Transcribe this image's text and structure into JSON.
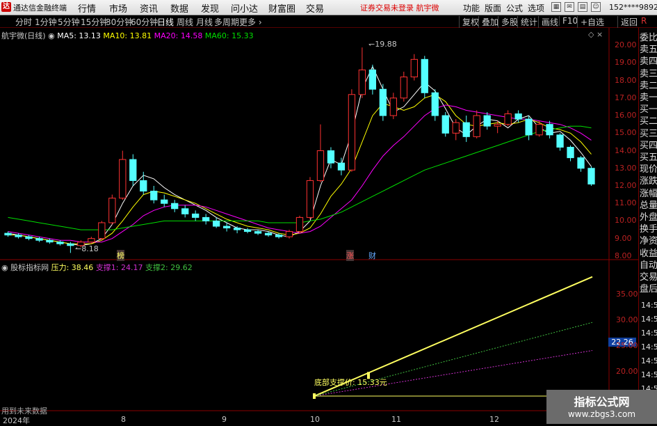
{
  "app": {
    "title": "通达信金融终端",
    "logo_glyph": "达"
  },
  "menu": {
    "items": [
      "行情",
      "市场",
      "资讯",
      "数据",
      "发现",
      "问小达",
      "财富圈",
      "交易"
    ],
    "warning": "证券交易未登录",
    "stock_name": "航宇微",
    "right_items": [
      "功能",
      "版面",
      "公式",
      "选项"
    ],
    "account": "152****9892"
  },
  "period_bar": {
    "periods": [
      "分时",
      "1分钟",
      "5分钟",
      "15分钟",
      "30分钟",
      "60分钟",
      "日线",
      "周线",
      "月线",
      "多周期",
      "更多"
    ],
    "active": "日线",
    "tools": [
      "复权",
      "叠加",
      "多股",
      "统计",
      "画线",
      "F10",
      "+自选",
      "返回"
    ],
    "r_icon": "R"
  },
  "main_legend": {
    "title": "航宇微(日线)",
    "ma5": "MA5: 13.13",
    "ma10": "MA10: 13.81",
    "ma20": "MA20: 14.58",
    "ma60": "MA60: 15.33"
  },
  "indicator_legend": {
    "name": "股标指标网",
    "pressure": "压力: 38.46",
    "support1": "支撑1: 24.17",
    "support2": "支撑2: 29.62"
  },
  "annotations": {
    "high": "19.88",
    "low": "8.18",
    "marker_bang": "榜",
    "marker_zhang": "涨",
    "marker_cai": "财",
    "bottom_support": "底部支撑价: 15.33元",
    "current_value": "22.26",
    "left_note": "用到未来数据"
  },
  "x_axis": {
    "labels": [
      "2024年",
      "8",
      "9",
      "10",
      "11",
      "12"
    ]
  },
  "colors": {
    "up": "#ff3232",
    "down": "#54ffff",
    "ma5": "#ffffff",
    "ma10": "#ffff00",
    "ma20": "#ff00ff",
    "ma60": "#00e000",
    "pressure": "#ffff60",
    "support1": "#d030d0",
    "support2": "#40c040"
  },
  "side_panel": {
    "items": [
      "委比",
      "卖五",
      "卖四",
      "卖三",
      "卖二",
      "卖一",
      "买一",
      "买二",
      "买三",
      "买四",
      "买五",
      "现价",
      "涨跌",
      "涨幅",
      "总量",
      "外盘",
      "换手",
      "净资",
      "收益",
      "自动",
      "交易",
      "盘后"
    ],
    "times": [
      "14:56",
      "14:56",
      "14:56",
      "14:56",
      "14:56",
      "14:56",
      "14:56",
      "14:56"
    ]
  },
  "watermark": {
    "line1": "指标公式网",
    "line2": "www.zbgs3.com"
  },
  "chart_data": [
    {
      "type": "candlestick",
      "title": "航宇微(日线)",
      "y_ticks": [
        20.0,
        19.0,
        18.0,
        17.0,
        16.0,
        15.0,
        14.0,
        13.0,
        12.0,
        11.0,
        10.0,
        9.0,
        8.0
      ],
      "ylim": [
        7.6,
        20.6
      ],
      "x_range": "2024-07 to 2024-12",
      "series": [
        {
          "name": "MA5",
          "values": [
            9.3,
            9.2,
            9.1,
            9.0,
            8.9,
            8.8,
            8.7,
            8.6,
            8.7,
            9.0,
            9.8,
            11.0,
            12.0,
            12.6,
            12.4,
            11.9,
            11.5,
            11.2,
            10.9,
            10.6,
            10.2,
            9.9,
            9.6,
            9.5,
            9.5,
            9.4,
            9.2,
            9.1,
            9.4,
            10.0,
            12.0,
            13.5,
            13.2,
            15.0,
            17.5,
            18.8,
            17.5,
            16.2,
            16.5,
            17.2,
            17.9,
            17.4,
            16.4,
            15.3,
            14.9,
            15.4,
            15.8,
            15.7,
            15.3,
            15.8,
            16.0,
            15.3,
            15.0,
            15.1,
            14.6,
            13.9,
            13.1
          ]
        },
        {
          "name": "MA10",
          "values": [
            9.2,
            9.2,
            9.1,
            9.0,
            8.9,
            8.8,
            8.7,
            8.7,
            8.7,
            8.9,
            9.3,
            10.0,
            10.8,
            11.5,
            11.7,
            11.6,
            11.4,
            11.2,
            11.0,
            10.7,
            10.4,
            10.1,
            9.9,
            9.7,
            9.6,
            9.5,
            9.3,
            9.2,
            9.3,
            9.6,
            10.4,
            11.4,
            12.1,
            13.0,
            14.5,
            16.0,
            16.7,
            16.5,
            16.3,
            16.5,
            17.0,
            17.2,
            16.8,
            16.0,
            15.5,
            15.4,
            15.5,
            15.6,
            15.5,
            15.6,
            15.8,
            15.6,
            15.3,
            15.2,
            15.0,
            14.5,
            13.8
          ]
        },
        {
          "name": "MA20",
          "values": [
            9.4,
            9.3,
            9.2,
            9.1,
            9.0,
            8.9,
            8.9,
            8.8,
            8.8,
            8.8,
            9.0,
            9.4,
            9.8,
            10.3,
            10.6,
            10.8,
            10.9,
            10.9,
            10.9,
            10.8,
            10.6,
            10.4,
            10.2,
            10.0,
            9.8,
            9.6,
            9.5,
            9.4,
            9.3,
            9.4,
            9.7,
            10.2,
            10.7,
            11.2,
            12.0,
            12.9,
            13.7,
            14.3,
            14.8,
            15.4,
            16.0,
            16.4,
            16.6,
            16.5,
            16.3,
            16.2,
            16.1,
            16.0,
            15.9,
            15.8,
            15.8,
            15.7,
            15.6,
            15.5,
            15.3,
            15.0,
            14.6
          ]
        },
        {
          "name": "MA60",
          "values": [
            10.2,
            10.1,
            10.0,
            9.9,
            9.8,
            9.7,
            9.6,
            9.5,
            9.5,
            9.5,
            9.5,
            9.6,
            9.7,
            9.8,
            9.9,
            10.0,
            10.0,
            10.0,
            10.0,
            10.0,
            10.0,
            10.0,
            10.0,
            10.0,
            10.0,
            9.9,
            9.9,
            9.9,
            9.9,
            10.0,
            10.1,
            10.3,
            10.5,
            10.8,
            11.1,
            11.4,
            11.7,
            12.0,
            12.3,
            12.6,
            12.9,
            13.1,
            13.3,
            13.5,
            13.7,
            13.9,
            14.1,
            14.3,
            14.5,
            14.7,
            14.9,
            15.1,
            15.2,
            15.3,
            15.4,
            15.4,
            15.3
          ]
        }
      ],
      "candles": [
        [
          9.3,
          9.4,
          9.1,
          9.2
        ],
        [
          9.2,
          9.3,
          9.0,
          9.1
        ],
        [
          9.1,
          9.2,
          8.9,
          9.0
        ],
        [
          9.0,
          9.1,
          8.8,
          8.9
        ],
        [
          8.9,
          9.0,
          8.7,
          8.8
        ],
        [
          8.8,
          8.9,
          8.6,
          8.7
        ],
        [
          8.7,
          8.8,
          8.18,
          8.6
        ],
        [
          8.6,
          8.9,
          8.5,
          8.8
        ],
        [
          8.8,
          9.1,
          8.7,
          9.0
        ],
        [
          9.0,
          10.0,
          8.9,
          9.9
        ],
        [
          9.9,
          11.5,
          9.8,
          11.3
        ],
        [
          11.3,
          14.0,
          11.2,
          13.5
        ],
        [
          13.5,
          13.8,
          12.0,
          12.3
        ],
        [
          12.3,
          12.8,
          11.5,
          11.7
        ],
        [
          11.7,
          12.0,
          11.0,
          11.2
        ],
        [
          11.2,
          11.5,
          10.8,
          11.0
        ],
        [
          11.0,
          11.2,
          10.5,
          10.7
        ],
        [
          10.7,
          10.9,
          10.2,
          10.4
        ],
        [
          10.4,
          10.6,
          10.0,
          10.2
        ],
        [
          10.2,
          10.4,
          9.8,
          10.0
        ],
        [
          10.0,
          10.2,
          9.6,
          9.7
        ],
        [
          9.7,
          9.9,
          9.4,
          9.6
        ],
        [
          9.6,
          9.7,
          9.3,
          9.5
        ],
        [
          9.5,
          9.6,
          9.3,
          9.4
        ],
        [
          9.4,
          9.5,
          9.2,
          9.3
        ],
        [
          9.3,
          9.4,
          9.1,
          9.2
        ],
        [
          9.2,
          9.3,
          9.0,
          9.1
        ],
        [
          9.1,
          9.5,
          9.0,
          9.4
        ],
        [
          9.4,
          10.3,
          9.3,
          10.2
        ],
        [
          10.2,
          12.5,
          10.1,
          12.3
        ],
        [
          12.3,
          15.5,
          12.2,
          14.0
        ],
        [
          14.0,
          14.2,
          13.0,
          13.3
        ],
        [
          13.3,
          13.6,
          12.6,
          12.9
        ],
        [
          12.9,
          17.5,
          12.8,
          17.2
        ],
        [
          17.2,
          19.88,
          17.0,
          18.6
        ],
        [
          18.6,
          18.9,
          17.2,
          17.5
        ],
        [
          17.5,
          17.8,
          15.7,
          16.0
        ],
        [
          16.0,
          17.3,
          15.8,
          17.0
        ],
        [
          17.0,
          18.5,
          16.8,
          18.2
        ],
        [
          18.2,
          19.5,
          18.0,
          19.2
        ],
        [
          19.2,
          19.4,
          17.0,
          17.3
        ],
        [
          17.3,
          17.5,
          15.7,
          16.0
        ],
        [
          16.0,
          16.2,
          14.8,
          15.0
        ],
        [
          15.0,
          15.8,
          14.6,
          15.6
        ],
        [
          15.6,
          16.0,
          14.5,
          14.8
        ],
        [
          14.8,
          16.3,
          14.7,
          16.0
        ],
        [
          16.0,
          16.2,
          15.2,
          15.4
        ],
        [
          15.4,
          15.7,
          15.0,
          15.5
        ],
        [
          15.5,
          16.3,
          15.4,
          16.1
        ],
        [
          16.1,
          16.3,
          15.6,
          15.8
        ],
        [
          15.8,
          16.0,
          14.6,
          14.9
        ],
        [
          14.9,
          15.7,
          14.8,
          15.5
        ],
        [
          15.5,
          15.7,
          14.7,
          14.9
        ],
        [
          14.9,
          15.0,
          14.0,
          14.2
        ],
        [
          14.2,
          14.3,
          13.4,
          13.6
        ],
        [
          13.6,
          13.7,
          12.8,
          13.0
        ],
        [
          13.0,
          13.1,
          12.0,
          12.1
        ]
      ]
    },
    {
      "type": "line",
      "title": "股标指标网",
      "y_ticks": [
        35.0,
        30.0,
        25.0,
        20.0,
        15.0
      ],
      "ylim": [
        12.5,
        39.5
      ],
      "series": [
        {
          "name": "压力",
          "x": [
            0,
            56
          ],
          "values": [
            15.33,
            38.46
          ]
        },
        {
          "name": "支撑1",
          "x": [
            0,
            56
          ],
          "values": [
            15.33,
            24.17
          ]
        },
        {
          "name": "支撑2",
          "x": [
            0,
            56
          ],
          "values": [
            15.33,
            29.62
          ]
        },
        {
          "name": "底部支撑价",
          "x": [
            0,
            56
          ],
          "values": [
            15.33,
            15.33
          ]
        }
      ],
      "current_value": 22.26
    }
  ]
}
